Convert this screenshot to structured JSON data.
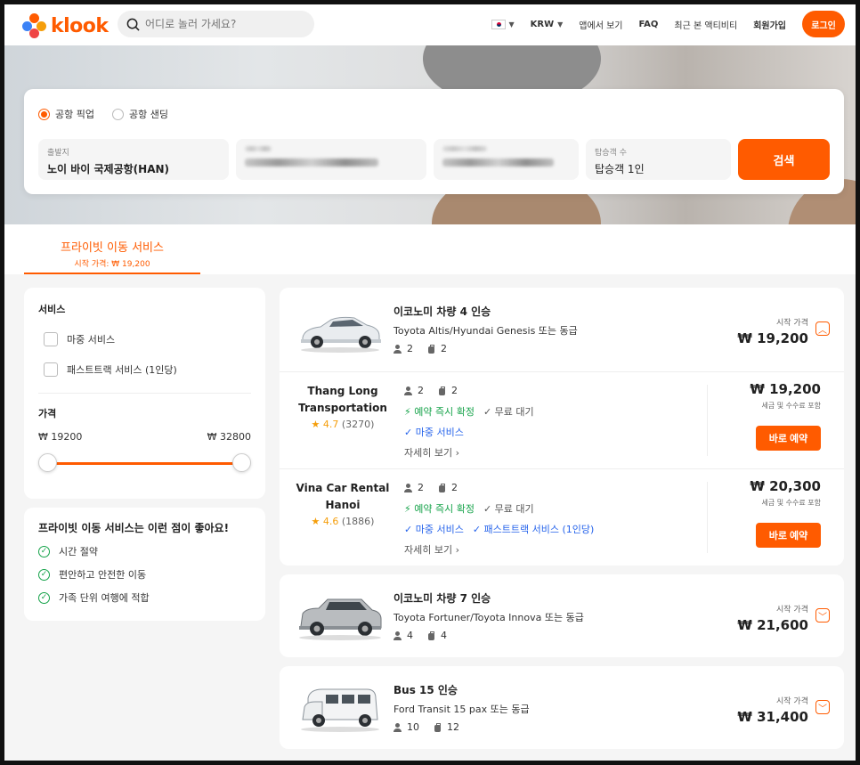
{
  "header": {
    "logo_text": "klook",
    "search_placeholder": "어디로 놀러 가세요?",
    "nav": {
      "currency": "KRW",
      "app": "앱에서 보기",
      "faq": "FAQ",
      "recent": "최근 본 액티비티",
      "signup": "회원가입",
      "login": "로그인"
    }
  },
  "search_card": {
    "radio_pickup": "공항 픽업",
    "radio_sending": "공항 샌딩",
    "from_label": "출발지",
    "from_value": "노이 바이 국제공항(HAN)",
    "pax_label": "탑승객 수",
    "pax_value": "탑승객 1인",
    "search_button": "검색"
  },
  "tab": {
    "title": "프라이빗 이동 서비스",
    "sub": "시작 가격: ₩ 19,200"
  },
  "filters": {
    "service_title": "서비스",
    "option1": "마중 서비스",
    "option2": "패스트트랙 서비스 (1인당)",
    "price_title": "가격",
    "min": "₩ 19200",
    "max": "₩ 32800"
  },
  "benefits": {
    "title": "프라이빗 이동 서비스는 이런 점이 좋아요!",
    "items": [
      "시간 절약",
      "편안하고 안전한 이동",
      "가족 단위 여행에 적합"
    ]
  },
  "results": [
    {
      "title": "이코노미 차량 4 인승",
      "sub": "Toyota Altis/Hyundai Genesis 또는 동급",
      "pax": "2",
      "bags": "2",
      "from": "시작 가격",
      "price": "₩ 19,200",
      "vendors": [
        {
          "name": "Thang Long Transportation",
          "score": "4.7",
          "reviews": "(3270)",
          "pax": "2",
          "bags": "2",
          "instant": "예약 즉시 확정",
          "free_wait": "무료 대기",
          "meet": "마중 서비스",
          "fasttrack": "",
          "more": "자세히 보기 ›",
          "price": "₩ 19,200",
          "tax": "세금 및 수수료 포함",
          "book": "바로 예약"
        },
        {
          "name": "Vina Car Rental Hanoi",
          "score": "4.6",
          "reviews": "(1886)",
          "pax": "2",
          "bags": "2",
          "instant": "예약 즉시 확정",
          "free_wait": "무료 대기",
          "meet": "마중 서비스",
          "fasttrack": "패스트트랙 서비스 (1인당)",
          "more": "자세히 보기 ›",
          "price": "₩ 20,300",
          "tax": "세금 및 수수료 포함",
          "book": "바로 예약"
        }
      ]
    },
    {
      "title": "이코노미 차량 7 인승",
      "sub": "Toyota Fortuner/Toyota Innova 또는 동급",
      "pax": "4",
      "bags": "4",
      "from": "시작 가격",
      "price": "₩ 21,600"
    },
    {
      "title": "Bus 15 인승",
      "sub": "Ford Transit 15 pax 또는 동급",
      "pax": "10",
      "bags": "12",
      "from": "시작 가격",
      "price": "₩ 31,400"
    }
  ],
  "colors": {
    "brand": "#ff5b00",
    "success": "#16a34a",
    "link": "#2563eb"
  }
}
